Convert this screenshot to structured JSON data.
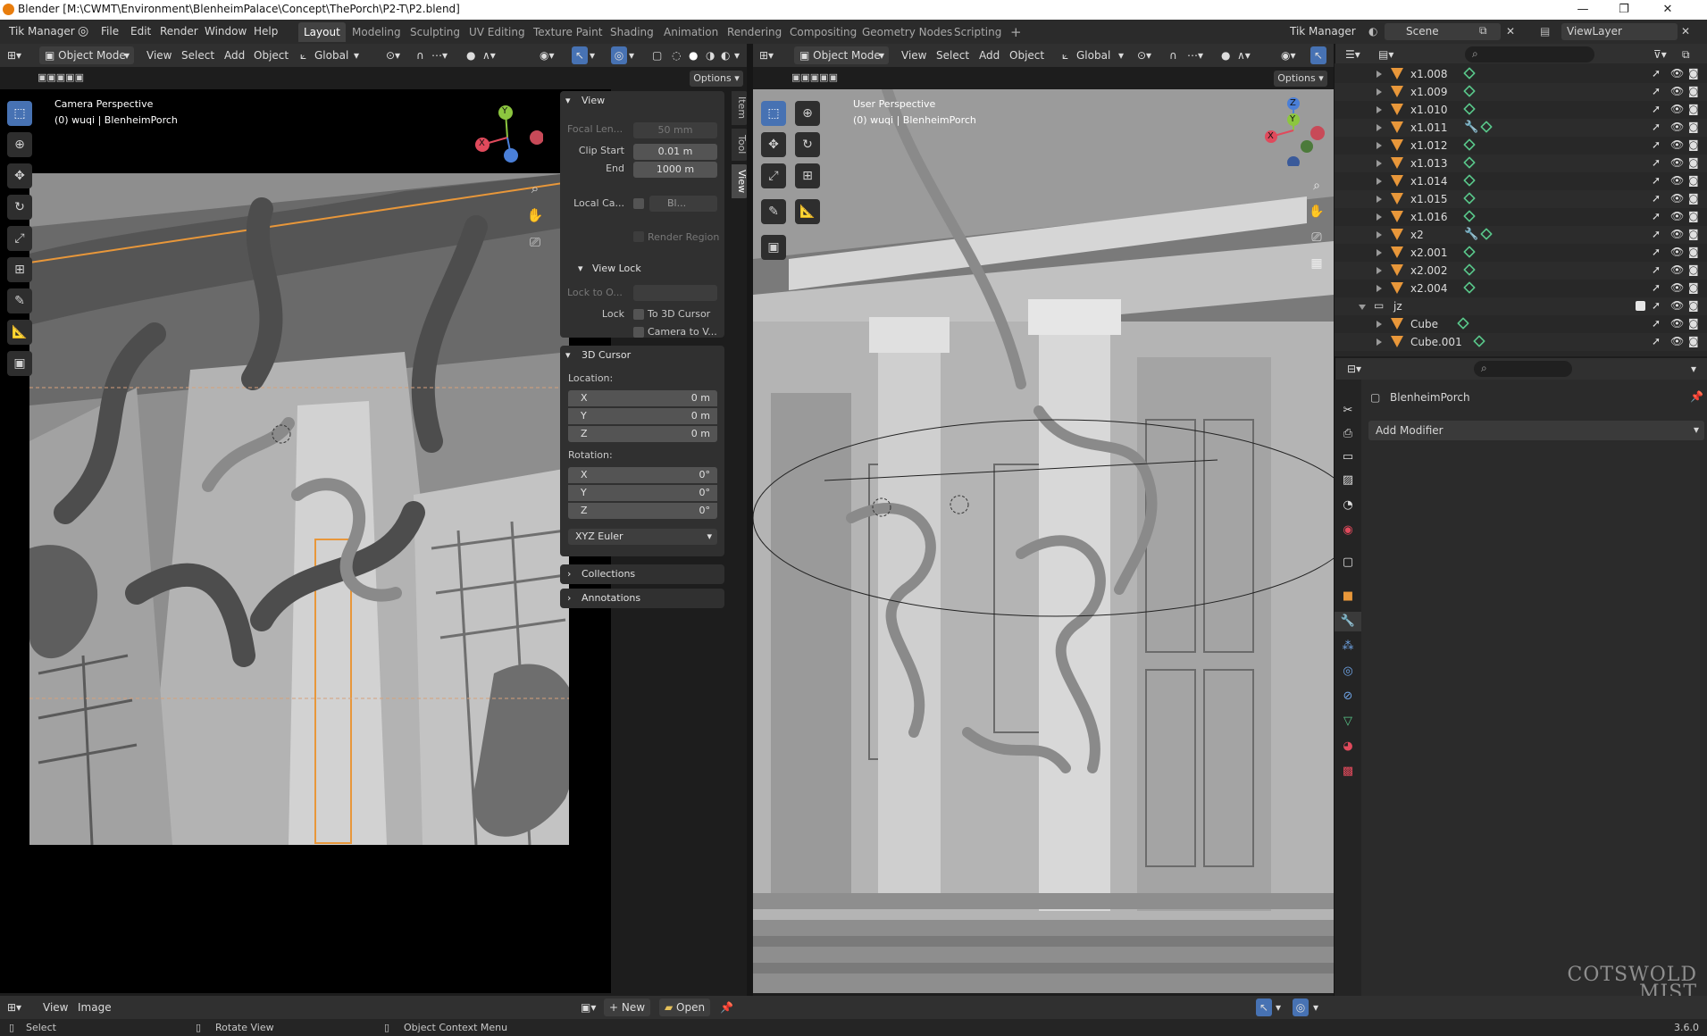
{
  "titlebar": {
    "title": "Blender [M:\\CWMT\\Environment\\BlenheimPalace\\Concept\\ThePorch\\P2-T\\P2.blend]",
    "minimize": "—",
    "maximize": "❐",
    "close": "✕"
  },
  "menubar": {
    "addon": "Tik Manager",
    "items": [
      "File",
      "Edit",
      "Render",
      "Window",
      "Help"
    ],
    "workspaces": [
      "Layout",
      "Modeling",
      "Sculpting",
      "UV Editing",
      "Texture Paint",
      "Shading",
      "Animation",
      "Rendering",
      "Compositing",
      "Geometry Nodes",
      "Scripting"
    ],
    "add_workspace": "+",
    "right_addon": "Tik Manager",
    "scene": "Scene",
    "view_layer": "ViewLayer"
  },
  "left_view": {
    "mode": "Object Mode",
    "menus": [
      "View",
      "Select",
      "Add",
      "Object"
    ],
    "orientation": "Global",
    "options": "Options",
    "perspective": "Camera Perspective",
    "object_info": "(0) wuqi | BlenheimPorch",
    "gizmo_y": "Y",
    "gizmo_x": "X"
  },
  "npanel": {
    "view_title": "View",
    "focal_label": "Focal Len...",
    "focal_value": "50 mm",
    "clip_start_label": "Clip Start",
    "clip_start_value": "0.01 m",
    "clip_end_label": "End",
    "clip_end_value": "1000 m",
    "local_cam_label": "Local Ca...",
    "local_cam_value": "Bl...",
    "render_region": "Render Region",
    "view_lock_title": "View Lock",
    "lock_to_label": "Lock to O...",
    "lock_label": "Lock",
    "to_cursor": "To 3D Cursor",
    "camera_to_view": "Camera to V...",
    "cursor_title": "3D Cursor",
    "location_label": "Location:",
    "loc_x": "0 m",
    "loc_y": "0 m",
    "loc_z": "0 m",
    "rotation_label": "Rotation:",
    "rot_x": "0°",
    "rot_y": "0°",
    "rot_z": "0°",
    "axis_x": "X",
    "axis_y": "Y",
    "axis_z": "Z",
    "rotation_mode": "XYZ Euler",
    "collections": "Collections",
    "annotations": "Annotations",
    "tabs": [
      "Item",
      "Tool",
      "View"
    ]
  },
  "right_view": {
    "mode": "Object Mode",
    "menus": [
      "View",
      "Select",
      "Add",
      "Object"
    ],
    "orientation": "Global",
    "options": "Options",
    "perspective": "User Perspective",
    "object_info": "(0) wuqi | BlenheimPorch",
    "gizmo_z": "Z",
    "gizmo_y": "Y",
    "gizmo_x": "X"
  },
  "outliner": {
    "rows": [
      {
        "name": "x1.008",
        "mod": false
      },
      {
        "name": "x1.009",
        "mod": false
      },
      {
        "name": "x1.010",
        "mod": false
      },
      {
        "name": "x1.011",
        "mod": true
      },
      {
        "name": "x1.012",
        "mod": false
      },
      {
        "name": "x1.013",
        "mod": false
      },
      {
        "name": "x1.014",
        "mod": false
      },
      {
        "name": "x1.015",
        "mod": false
      },
      {
        "name": "x1.016",
        "mod": false
      },
      {
        "name": "x2",
        "mod": true
      },
      {
        "name": "x2.001",
        "mod": false
      },
      {
        "name": "x2.002",
        "mod": false
      },
      {
        "name": "x2.004",
        "mod": false
      }
    ],
    "collection": "jz",
    "children": [
      "Cube",
      "Cube.001"
    ]
  },
  "properties": {
    "object_name": "BlenheimPorch",
    "add_modifier": "Add Modifier"
  },
  "image_editor": {
    "menus": [
      "View",
      "Image"
    ],
    "new": "New",
    "open": "Open"
  },
  "watermark": {
    "line1": "COTSWOLD",
    "line2": "MIST"
  },
  "statusbar": {
    "select": "Select",
    "rotate": "Rotate View",
    "context": "Object Context Menu",
    "version": "3.6.0"
  },
  "colors": {
    "accent": "#4772b3",
    "object_orange": "#e8973a",
    "mesh_green": "#59c78a",
    "axis_x": "#e04a5c",
    "axis_y": "#8cc63f",
    "axis_z": "#4a7fd8"
  }
}
